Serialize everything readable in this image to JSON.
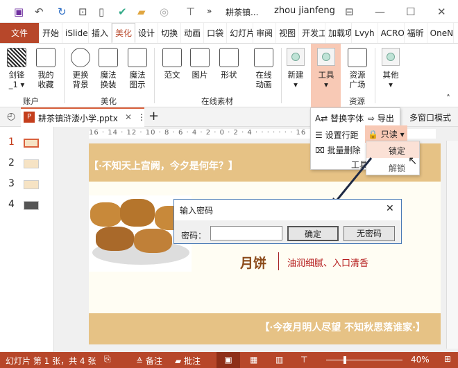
{
  "titlebar": {
    "doc_short": "耕茶镇...",
    "user": "zhou jianfeng",
    "more": "»",
    "minimize": "—",
    "maximize": "☐",
    "close": "✕"
  },
  "tabs": [
    "文件",
    "开始",
    "iSlide",
    "插入",
    "美化",
    "设计",
    "切换",
    "动画",
    "口袋",
    "幻灯片",
    "审阅",
    "视图",
    "开发工",
    "加载项",
    "Lvyh",
    "ACRO",
    "福昕",
    "OneN"
  ],
  "active_tab": "美化",
  "ribbon": {
    "buttons": [
      {
        "label1": "剑锋",
        "label2": "_1 ▾",
        "icon": "qr-code-icon"
      },
      {
        "label1": "我的",
        "label2": "收藏",
        "icon": "heart-folder-icon"
      },
      {
        "label1": "更换",
        "label2": "背景",
        "icon": "refresh-icon"
      },
      {
        "label1": "魔法",
        "label2": "换装",
        "icon": "magic-wand-icon"
      },
      {
        "label1": "魔法",
        "label2": "图示",
        "icon": "magic-diagram-icon"
      },
      {
        "label1": "范文",
        "label2": "",
        "icon": "document-icon"
      },
      {
        "label1": "图片",
        "label2": "",
        "icon": "picture-icon"
      },
      {
        "label1": "形状",
        "label2": "",
        "icon": "shapes-icon"
      },
      {
        "label1": "在线",
        "label2": "动画",
        "icon": "animation-icon"
      },
      {
        "label1": "新建",
        "label2": "▾",
        "icon": "circle-icon"
      },
      {
        "label1": "工具",
        "label2": "▾",
        "icon": "circle-icon"
      },
      {
        "label1": "资源",
        "label2": "广场",
        "icon": "grid-icon"
      },
      {
        "label1": "其他",
        "label2": "▾",
        "icon": "circle-icon"
      }
    ],
    "groups": [
      "账户",
      "美化",
      "在线素材",
      "资源"
    ],
    "collapse": "˄"
  },
  "doctab": {
    "name": "耕茶镇浒溇小学.pptx",
    "close": "✕",
    "menu": "⋮",
    "add": "+",
    "multiwindow": "多窗口模式"
  },
  "ruler": "16 · 14 · 12 · 10 · 8 · 6 · 4 · 2 · 0 · 2 · 4 · · · · · · · 16",
  "thumbs": [
    "1",
    "2",
    "3",
    "4"
  ],
  "slide": {
    "top_text": "【·不知天上宫阙，今夕是何年？】",
    "title": "月饼",
    "subtitle": "油润细腻、入口清香",
    "bottom_text": "【·今夜月明人尽望 不知秋思落谁家·】"
  },
  "dropdown": {
    "items": [
      "替换字体",
      "导出",
      "设置行距",
      "只读 ▾",
      "批量删除"
    ],
    "group": "工具"
  },
  "submenu": {
    "items": [
      "锁定",
      "解锁"
    ]
  },
  "dialog": {
    "title": "输入密码",
    "close": "✕",
    "label": "密码：",
    "value": "",
    "ok": "确定",
    "nopass": "无密码"
  },
  "status": {
    "slide_info": "幻灯片 第 1 张，共 4 张",
    "notes": "备注",
    "comments": "批注",
    "zoom": "40%"
  },
  "colors": {
    "accent": "#b7472a",
    "band": "#e6c285",
    "highlight": "#f8c9b5"
  }
}
